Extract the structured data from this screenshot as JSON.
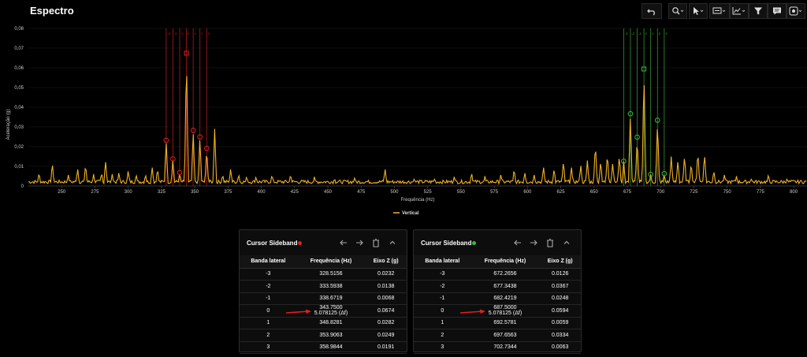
{
  "header": {
    "title": "Espectro"
  },
  "toolbar": [
    {
      "icon": "undo-icon"
    },
    {
      "icon": "zoom-icon"
    },
    {
      "icon": "pointer-icon"
    },
    {
      "icon": "cursor-mode-icon"
    },
    {
      "icon": "chart-type-icon"
    },
    {
      "icon": "filter-icon"
    },
    {
      "icon": "comment-icon"
    },
    {
      "icon": "settings-icon"
    }
  ],
  "chart_data": {
    "type": "line",
    "xlabel": "Frequência (Hz)",
    "ylabel": "Aceleração (g)",
    "xlim": [
      225,
      810
    ],
    "ylim": [
      0,
      0.08
    ],
    "xticks": [
      250,
      275,
      300,
      325,
      350,
      375,
      400,
      425,
      450,
      475,
      500,
      525,
      550,
      575,
      600,
      625,
      650,
      675,
      700,
      725,
      750,
      775,
      800
    ],
    "ytick_labels": [
      "0",
      "0,01",
      "0,02",
      "0,03",
      "0,04",
      "0,05",
      "0,06",
      "0,07",
      "0,08"
    ],
    "legend": "bottom-center",
    "series": [
      {
        "name": "Vertical",
        "color": "#f2b21f",
        "peaks": [
          {
            "x": 233,
            "y": 0.007
          },
          {
            "x": 243,
            "y": 0.012
          },
          {
            "x": 255,
            "y": 0.006
          },
          {
            "x": 262,
            "y": 0.009
          },
          {
            "x": 268,
            "y": 0.011
          },
          {
            "x": 274,
            "y": 0.006
          },
          {
            "x": 280,
            "y": 0.007
          },
          {
            "x": 283,
            "y": 0.013
          },
          {
            "x": 288,
            "y": 0.006
          },
          {
            "x": 293,
            "y": 0.007
          },
          {
            "x": 300,
            "y": 0.008
          },
          {
            "x": 306,
            "y": 0.006
          },
          {
            "x": 313,
            "y": 0.006
          },
          {
            "x": 318,
            "y": 0.01
          },
          {
            "x": 322,
            "y": 0.009
          },
          {
            "x": 328.5,
            "y": 0.0232
          },
          {
            "x": 333.6,
            "y": 0.0138
          },
          {
            "x": 338.7,
            "y": 0.0068
          },
          {
            "x": 343.75,
            "y": 0.0674
          },
          {
            "x": 348.8,
            "y": 0.0282
          },
          {
            "x": 353.9,
            "y": 0.0249
          },
          {
            "x": 359,
            "y": 0.0191
          },
          {
            "x": 365,
            "y": 0.029
          },
          {
            "x": 371,
            "y": 0.006
          },
          {
            "x": 377,
            "y": 0.009
          },
          {
            "x": 383,
            "y": 0.006
          },
          {
            "x": 389,
            "y": 0.005
          },
          {
            "x": 396,
            "y": 0.005
          },
          {
            "x": 408,
            "y": 0.006
          },
          {
            "x": 422,
            "y": 0.006
          },
          {
            "x": 440,
            "y": 0.005
          },
          {
            "x": 455,
            "y": 0.004
          },
          {
            "x": 470,
            "y": 0.004
          },
          {
            "x": 493,
            "y": 0.009
          },
          {
            "x": 515,
            "y": 0.004
          },
          {
            "x": 530,
            "y": 0.004
          },
          {
            "x": 545,
            "y": 0.005
          },
          {
            "x": 558,
            "y": 0.007
          },
          {
            "x": 568,
            "y": 0.005
          },
          {
            "x": 580,
            "y": 0.006
          },
          {
            "x": 590,
            "y": 0.009
          },
          {
            "x": 598,
            "y": 0.007
          },
          {
            "x": 605,
            "y": 0.006
          },
          {
            "x": 612,
            "y": 0.01
          },
          {
            "x": 620,
            "y": 0.009
          },
          {
            "x": 627,
            "y": 0.013
          },
          {
            "x": 633,
            "y": 0.01
          },
          {
            "x": 640,
            "y": 0.011
          },
          {
            "x": 645,
            "y": 0.013
          },
          {
            "x": 651,
            "y": 0.022
          },
          {
            "x": 655,
            "y": 0.013
          },
          {
            "x": 660,
            "y": 0.017
          },
          {
            "x": 664,
            "y": 0.012
          },
          {
            "x": 669,
            "y": 0.016
          },
          {
            "x": 672.3,
            "y": 0.0126
          },
          {
            "x": 677.3,
            "y": 0.0367
          },
          {
            "x": 682.4,
            "y": 0.0248
          },
          {
            "x": 687.5,
            "y": 0.0594
          },
          {
            "x": 692.6,
            "y": 0.0059
          },
          {
            "x": 697.7,
            "y": 0.0334
          },
          {
            "x": 702.7,
            "y": 0.0063
          },
          {
            "x": 708,
            "y": 0.015
          },
          {
            "x": 713,
            "y": 0.013
          },
          {
            "x": 718,
            "y": 0.016
          },
          {
            "x": 723,
            "y": 0.012
          },
          {
            "x": 728,
            "y": 0.018
          },
          {
            "x": 733,
            "y": 0.017
          },
          {
            "x": 740,
            "y": 0.008
          },
          {
            "x": 748,
            "y": 0.006
          },
          {
            "x": 757,
            "y": 0.005
          },
          {
            "x": 768,
            "y": 0.004
          },
          {
            "x": 781,
            "y": 0.006
          },
          {
            "x": 795,
            "y": 0.004
          },
          {
            "x": 805,
            "y": 0.003
          }
        ]
      }
    ],
    "cursor_groups": [
      {
        "color": "#e02020",
        "lines": [
          328.5156,
          333.5938,
          338.6719,
          343.75,
          348.8281,
          353.9063,
          358.9844
        ],
        "line_labels": [
          "-3",
          "-2",
          "-1",
          "0",
          "1",
          "2",
          "3"
        ],
        "markers": [
          {
            "x": 328.5156,
            "y": 0.0232
          },
          {
            "x": 333.5938,
            "y": 0.0138
          },
          {
            "x": 338.6719,
            "y": 0.0068
          },
          {
            "x": 343.75,
            "y": 0.0674
          },
          {
            "x": 348.8281,
            "y": 0.0282
          },
          {
            "x": 353.9063,
            "y": 0.0249
          },
          {
            "x": 358.9844,
            "y": 0.0191
          }
        ]
      },
      {
        "color": "#3fb83f",
        "lines": [
          672.2656,
          677.3438,
          682.4219,
          687.5,
          692.5781,
          697.6563,
          702.7344
        ],
        "line_labels": [
          "-3",
          "-2",
          "-1",
          "0",
          "1",
          "2",
          "3"
        ],
        "markers": [
          {
            "x": 672.2656,
            "y": 0.0126
          },
          {
            "x": 677.3438,
            "y": 0.0367
          },
          {
            "x": 682.4219,
            "y": 0.0248
          },
          {
            "x": 687.5,
            "y": 0.0594
          },
          {
            "x": 692.5781,
            "y": 0.0059
          },
          {
            "x": 697.6563,
            "y": 0.0334
          },
          {
            "x": 702.7344,
            "y": 0.0063
          }
        ]
      }
    ]
  },
  "panels": [
    {
      "title": "Cursor Sideband",
      "dot_color": "#e02020",
      "headers": [
        "Banda lateral",
        "Frequência (Hz)",
        "Eixo Z (g)"
      ],
      "rows": [
        {
          "band": "-3",
          "freq": "328.5156",
          "z": "0.0232"
        },
        {
          "band": "-2",
          "freq": "333.5938",
          "z": "0.0138"
        },
        {
          "band": "-1",
          "freq": "338.6719",
          "z": "0.0068"
        },
        {
          "band": "0",
          "freq": "343.7500",
          "freq2": "5.078125 (Δf)",
          "z": "0.0674"
        },
        {
          "band": "1",
          "freq": "348.8281",
          "z": "0.0282"
        },
        {
          "band": "2",
          "freq": "353.9063",
          "z": "0.0249"
        },
        {
          "band": "3",
          "freq": "358.9844",
          "z": "0.0191"
        }
      ]
    },
    {
      "title": "Cursor Sideband",
      "dot_color": "#3fb83f",
      "headers": [
        "Banda lateral",
        "Frequência (Hz)",
        "Eixo Z (g)"
      ],
      "rows": [
        {
          "band": "-3",
          "freq": "672.2656",
          "z": "0.0126"
        },
        {
          "band": "-2",
          "freq": "677.3438",
          "z": "0.0367"
        },
        {
          "band": "-1",
          "freq": "682.4219",
          "z": "0.0248"
        },
        {
          "band": "0",
          "freq": "687.5000",
          "freq2": "5.078125 (Δf)",
          "z": "0.0594"
        },
        {
          "band": "1",
          "freq": "692.5781",
          "z": "0.0059"
        },
        {
          "band": "2",
          "freq": "697.6563",
          "z": "0.0334"
        },
        {
          "band": "3",
          "freq": "702.7344",
          "z": "0.0063"
        }
      ]
    }
  ],
  "annotations": {
    "arrow_color": "#e02020"
  }
}
